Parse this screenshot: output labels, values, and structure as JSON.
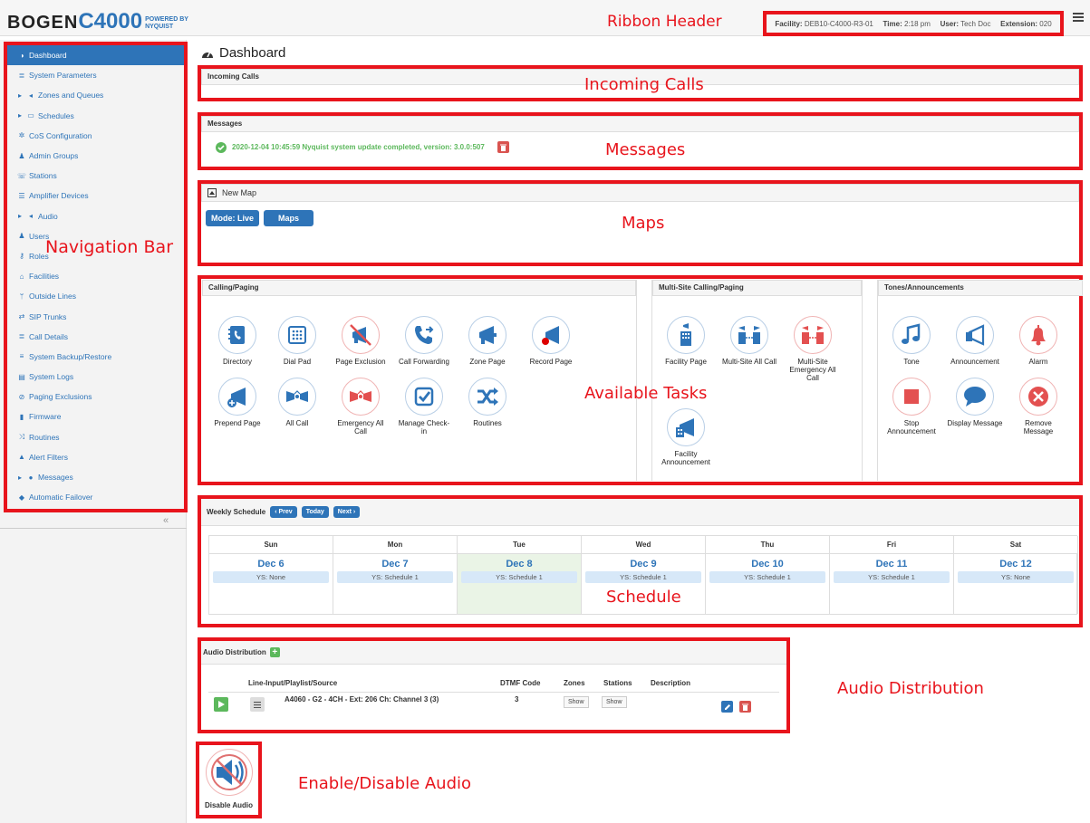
{
  "header": {
    "logo_main": "BOGEN",
    "logo_model": "C4000",
    "logo_powered": "POWERED BY",
    "logo_brand": "NYQUIST",
    "facility_label": "Facility:",
    "facility_value": "DEB10-C4000-R3-01",
    "time_label": "Time:",
    "time_value": "2:18 pm",
    "user_label": "User:",
    "user_value": "Tech Doc",
    "extension_label": "Extension:",
    "extension_value": "020"
  },
  "annotations": {
    "ribbon_header": "Ribbon Header",
    "incoming_calls": "Incoming Calls",
    "messages": "Messages",
    "maps": "Maps",
    "navigation_bar": "Navigation Bar",
    "available_tasks": "Available Tasks",
    "schedule": "Schedule",
    "audio_distribution": "Audio Distribution",
    "enable_disable_audio": "Enable/Disable Audio"
  },
  "sidebar": {
    "items": [
      {
        "icon": "dashboard-icon",
        "label": "Dashboard",
        "active": true
      },
      {
        "icon": "list-icon",
        "label": "System Parameters"
      },
      {
        "icon": "speaker-icon",
        "label": "Zones and Queues",
        "caret": true
      },
      {
        "icon": "calendar-icon",
        "label": "Schedules",
        "caret": true
      },
      {
        "icon": "cogs-icon",
        "label": "CoS Configuration"
      },
      {
        "icon": "group-icon",
        "label": "Admin Groups"
      },
      {
        "icon": "phone-icon",
        "label": "Stations"
      },
      {
        "icon": "server-icon",
        "label": "Amplifier Devices"
      },
      {
        "icon": "volume-icon",
        "label": "Audio",
        "caret": true
      },
      {
        "icon": "user-icon",
        "label": "Users"
      },
      {
        "icon": "key-icon",
        "label": "Roles"
      },
      {
        "icon": "building-icon",
        "label": "Facilities"
      },
      {
        "icon": "fork-icon",
        "label": "Outside Lines"
      },
      {
        "icon": "exchange-icon",
        "label": "SIP Trunks"
      },
      {
        "icon": "list-icon",
        "label": "Call Details"
      },
      {
        "icon": "database-icon",
        "label": "System Backup/Restore"
      },
      {
        "icon": "file-icon",
        "label": "System Logs"
      },
      {
        "icon": "ban-icon",
        "label": "Paging Exclusions"
      },
      {
        "icon": "chip-icon",
        "label": "Firmware"
      },
      {
        "icon": "random-icon",
        "label": "Routines"
      },
      {
        "icon": "warning-icon",
        "label": "Alert Filters"
      },
      {
        "icon": "comment-icon",
        "label": "Messages",
        "caret": true
      },
      {
        "icon": "shield-icon",
        "label": "Automatic Failover"
      }
    ],
    "collapse_glyph": "«"
  },
  "dashboard": {
    "title": "Dashboard",
    "incoming_calls_title": "Incoming Calls",
    "messages_title": "Messages",
    "message_text": "2020-12-04 10:45:59 Nyquist system update completed, version: 3.0.0:507",
    "map_title": "New Map",
    "mode_button": "Mode: Live",
    "maps_button": "Maps"
  },
  "tasks": {
    "calling_paging_title": "Calling/Paging",
    "multisite_title": "Multi-Site Calling/Paging",
    "tones_title": "Tones/Announcements",
    "calling": [
      {
        "label": "Directory",
        "icon": "directory-icon"
      },
      {
        "label": "Dial Pad",
        "icon": "dialpad-icon"
      },
      {
        "label": "Page Exclusion",
        "icon": "page-exclusion-icon"
      },
      {
        "label": "Call Forwarding",
        "icon": "call-forwarding-icon"
      },
      {
        "label": "Zone Page",
        "icon": "megaphone-icon"
      },
      {
        "label": "Record Page",
        "icon": "record-page-icon"
      },
      {
        "label": "Prepend Page",
        "icon": "prepend-page-icon"
      },
      {
        "label": "All Call",
        "icon": "all-call-icon"
      },
      {
        "label": "Emergency All Call",
        "icon": "emergency-all-call-icon"
      },
      {
        "label": "Manage Check-in",
        "icon": "checkin-icon"
      },
      {
        "label": "Routines",
        "icon": "routines-icon"
      }
    ],
    "multisite": [
      {
        "label": "Facility Page",
        "icon": "facility-page-icon"
      },
      {
        "label": "Multi-Site All Call",
        "icon": "multisite-all-call-icon"
      },
      {
        "label": "Multi-Site Emergency All Call",
        "icon": "multisite-emergency-icon"
      },
      {
        "label": "Facility Announcement",
        "icon": "facility-announcement-icon"
      }
    ],
    "tones": [
      {
        "label": "Tone",
        "icon": "music-icon"
      },
      {
        "label": "Announcement",
        "icon": "announcement-icon"
      },
      {
        "label": "Alarm",
        "icon": "bell-icon"
      },
      {
        "label": "Stop Announcement",
        "icon": "stop-icon"
      },
      {
        "label": "Display Message",
        "icon": "speech-bubble-icon"
      },
      {
        "label": "Remove Message",
        "icon": "remove-icon"
      }
    ]
  },
  "schedule": {
    "title": "Weekly Schedule",
    "prev": "Prev",
    "today": "Today",
    "next": "Next",
    "days": [
      {
        "day": "Sun",
        "date": "Dec 6",
        "ys": "YS: None"
      },
      {
        "day": "Mon",
        "date": "Dec 7",
        "ys": "YS: Schedule 1"
      },
      {
        "day": "Tue",
        "date": "Dec 8",
        "ys": "YS: Schedule 1",
        "today": true
      },
      {
        "day": "Wed",
        "date": "Dec 9",
        "ys": "YS: Schedule 1"
      },
      {
        "day": "Thu",
        "date": "Dec 10",
        "ys": "YS: Schedule 1"
      },
      {
        "day": "Fri",
        "date": "Dec 11",
        "ys": "YS: Schedule 1"
      },
      {
        "day": "Sat",
        "date": "Dec 12",
        "ys": "YS: None"
      }
    ]
  },
  "audio_distribution": {
    "title": "Audio Distribution",
    "columns": [
      "Line-Input/Playlist/Source",
      "DTMF Code",
      "Zones",
      "Stations",
      "Description"
    ],
    "row": {
      "source": "A4060 - G2 - 4CH - Ext: 206 Ch: Channel 3 (3)",
      "dtmf": "3",
      "zones_button": "Show",
      "stations_button": "Show",
      "description": ""
    }
  },
  "disable_audio": {
    "label": "Disable Audio"
  },
  "colors": {
    "accent": "#2e74b8",
    "annotation": "#e8141c",
    "success": "#5cb85c",
    "danger": "#d9534f"
  }
}
